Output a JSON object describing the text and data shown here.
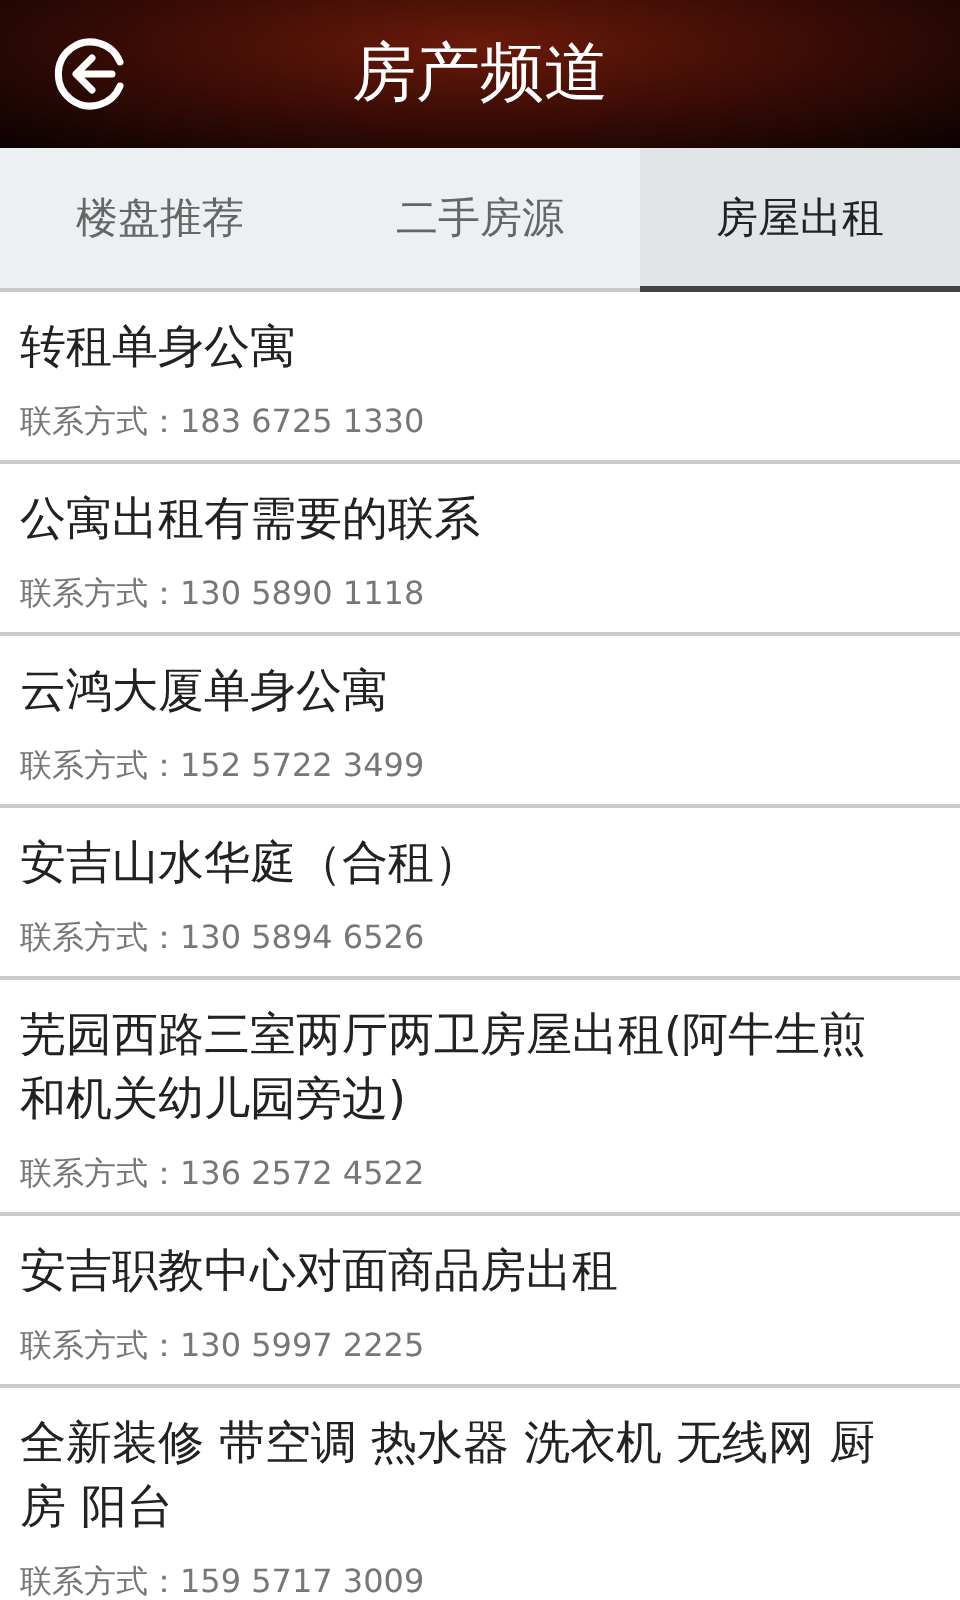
{
  "header": {
    "title": "房产频道"
  },
  "tabs": [
    {
      "label": "楼盘推荐",
      "selected": false
    },
    {
      "label": "二手房源",
      "selected": false
    },
    {
      "label": "房屋出租",
      "selected": true
    }
  ],
  "listings": [
    {
      "title": "转租单身公寓",
      "contact": "联系方式：183 6725 1330"
    },
    {
      "title": "公寓出租有需要的联系",
      "contact": "联系方式：130 5890 1118"
    },
    {
      "title": "云鸿大厦单身公寓",
      "contact": "联系方式：152 5722 3499"
    },
    {
      "title": "安吉山水华庭（合租）",
      "contact": "联系方式：130 5894 6526"
    },
    {
      "title": "芜园西路三室两厅两卫房屋出租(阿牛生煎和机关幼儿园旁边)",
      "contact": "联系方式：136 2572 4522"
    },
    {
      "title": "安吉职教中心对面商品房出租",
      "contact": "联系方式：130 5997 2225"
    },
    {
      "title": "全新装修 带空调 热水器 洗衣机 无线网 厨房 阳台",
      "contact": "联系方式：159 5717 3009"
    }
  ]
}
